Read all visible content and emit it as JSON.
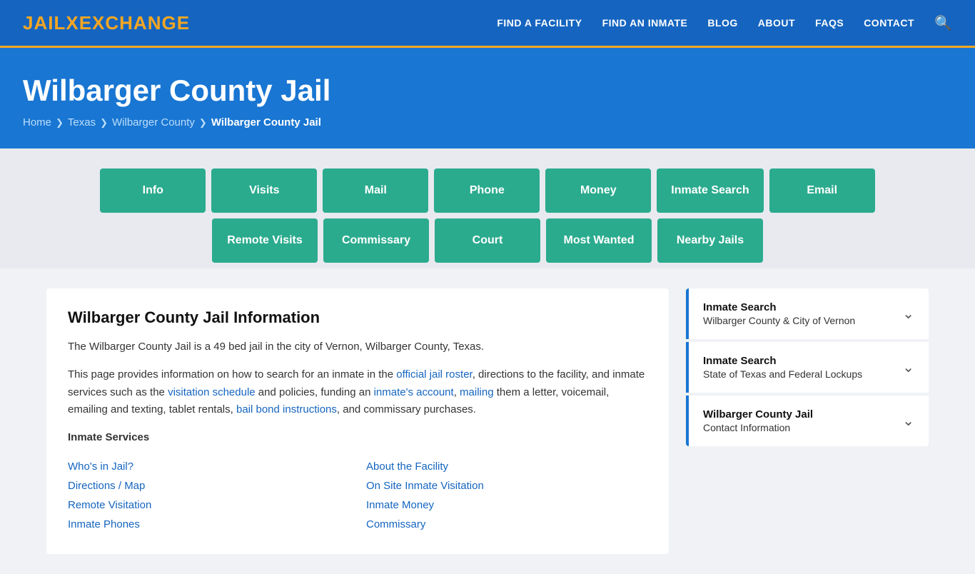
{
  "header": {
    "logo_jail": "JAIL",
    "logo_exchange": "EXCHANGE",
    "nav": [
      {
        "label": "FIND A FACILITY",
        "id": "find-facility"
      },
      {
        "label": "FIND AN INMATE",
        "id": "find-inmate"
      },
      {
        "label": "BLOG",
        "id": "blog"
      },
      {
        "label": "ABOUT",
        "id": "about"
      },
      {
        "label": "FAQs",
        "id": "faqs"
      },
      {
        "label": "CONTACT",
        "id": "contact"
      }
    ]
  },
  "hero": {
    "title": "Wilbarger County Jail",
    "breadcrumb": [
      {
        "label": "Home",
        "href": "#"
      },
      {
        "label": "Texas",
        "href": "#"
      },
      {
        "label": "Wilbarger County",
        "href": "#"
      },
      {
        "label": "Wilbarger County Jail",
        "current": true
      }
    ]
  },
  "tabs": {
    "row1": [
      {
        "label": "Info"
      },
      {
        "label": "Visits"
      },
      {
        "label": "Mail"
      },
      {
        "label": "Phone"
      },
      {
        "label": "Money"
      },
      {
        "label": "Inmate Search"
      },
      {
        "label": "Email"
      }
    ],
    "row2": [
      {
        "label": "Remote Visits"
      },
      {
        "label": "Commissary"
      },
      {
        "label": "Court"
      },
      {
        "label": "Most Wanted"
      },
      {
        "label": "Nearby Jails"
      }
    ]
  },
  "main": {
    "section_title": "Wilbarger County Jail Information",
    "paragraphs": [
      "The Wilbarger County Jail is a 49 bed jail in the city of Vernon, Wilbarger County, Texas.",
      "This page provides information on how to search for an inmate in the official jail roster, directions to the facility, and inmate services such as the visitation schedule and policies, funding an inmate's account, mailing them a letter, voicemail, emailing and texting, tablet rentals, bail bond instructions, and commissary purchases."
    ],
    "links_inline": [
      {
        "label": "official jail roster",
        "key": "official_jail_roster"
      },
      {
        "label": "visitation schedule",
        "key": "visitation_schedule"
      },
      {
        "label": "inmate's account",
        "key": "inmates_account"
      },
      {
        "label": "mailing",
        "key": "mailing"
      },
      {
        "label": "bail bond instructions",
        "key": "bail_bond_instructions"
      }
    ],
    "services_title": "Inmate Services",
    "services_left": [
      {
        "label": "Who's in Jail?"
      },
      {
        "label": "Directions / Map"
      },
      {
        "label": "Remote Visitation"
      },
      {
        "label": "Inmate Phones"
      }
    ],
    "services_right": [
      {
        "label": "About the Facility"
      },
      {
        "label": "On Site Inmate Visitation"
      },
      {
        "label": "Inmate Money"
      },
      {
        "label": "Commissary"
      }
    ]
  },
  "sidebar": {
    "cards": [
      {
        "title": "Inmate Search",
        "subtitle": "Wilbarger County & City of Vernon"
      },
      {
        "title": "Inmate Search",
        "subtitle": "State of Texas and Federal Lockups"
      },
      {
        "title": "Wilbarger County Jail",
        "subtitle": "Contact Information"
      }
    ]
  }
}
